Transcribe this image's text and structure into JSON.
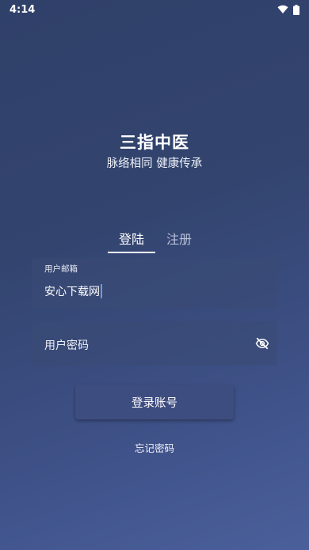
{
  "status_bar": {
    "time": "4:14",
    "icons": [
      "wifi-icon",
      "battery-icon"
    ]
  },
  "app": {
    "title": "三指中医",
    "subtitle": "脉络相同 健康传承"
  },
  "tabs": [
    {
      "label": "登陆",
      "active": true
    },
    {
      "label": "注册",
      "active": false
    }
  ],
  "form": {
    "email": {
      "label": "用户邮箱",
      "value": "安心下载网"
    },
    "password": {
      "placeholder": "用户密码",
      "toggle_icon": "visibility-off-icon"
    }
  },
  "buttons": {
    "login_label": "登录账号",
    "forgot_label": "忘记密码"
  },
  "colors": {
    "background_top": "#2f4069",
    "background_bottom": "#4b5f9b",
    "button": "#3e4d80",
    "caret": "#6f9ad8"
  }
}
